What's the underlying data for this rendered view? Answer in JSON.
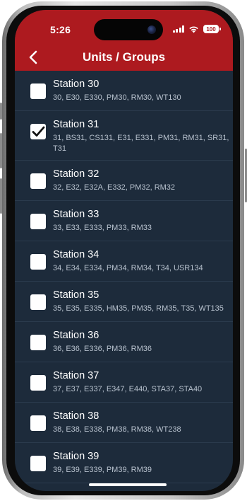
{
  "status_bar": {
    "time": "5:26",
    "battery": "100"
  },
  "nav": {
    "title": "Units / Groups"
  },
  "stations": [
    {
      "name": "Station 30",
      "units": "30, E30, E330, PM30, RM30, WT130",
      "checked": false
    },
    {
      "name": "Station 31",
      "units": "31, BS31, CS131, E31, E331, PM31, RM31, SR31, T31",
      "checked": true
    },
    {
      "name": "Station 32",
      "units": "32, E32, E32A, E332, PM32, RM32",
      "checked": false
    },
    {
      "name": "Station 33",
      "units": "33, E33, E333, PM33, RM33",
      "checked": false
    },
    {
      "name": "Station 34",
      "units": "34, E34, E334, PM34, RM34, T34, USR134",
      "checked": false
    },
    {
      "name": "Station 35",
      "units": "35, E35, E335, HM35, PM35, RM35, T35, WT135",
      "checked": false
    },
    {
      "name": "Station 36",
      "units": "36, E36, E336, PM36, RM36",
      "checked": false
    },
    {
      "name": "Station 37",
      "units": "37, E37, E337, E347, E440, STA37, STA40",
      "checked": false
    },
    {
      "name": "Station 38",
      "units": "38, E38, E338, PM38, RM38, WT238",
      "checked": false
    },
    {
      "name": "Station 39",
      "units": "39, E39, E339, PM39, RM39",
      "checked": false
    }
  ],
  "colors": {
    "header": "#ad1a1f",
    "list_background": "#1d2b3b",
    "checkbox": "#ffffff"
  }
}
